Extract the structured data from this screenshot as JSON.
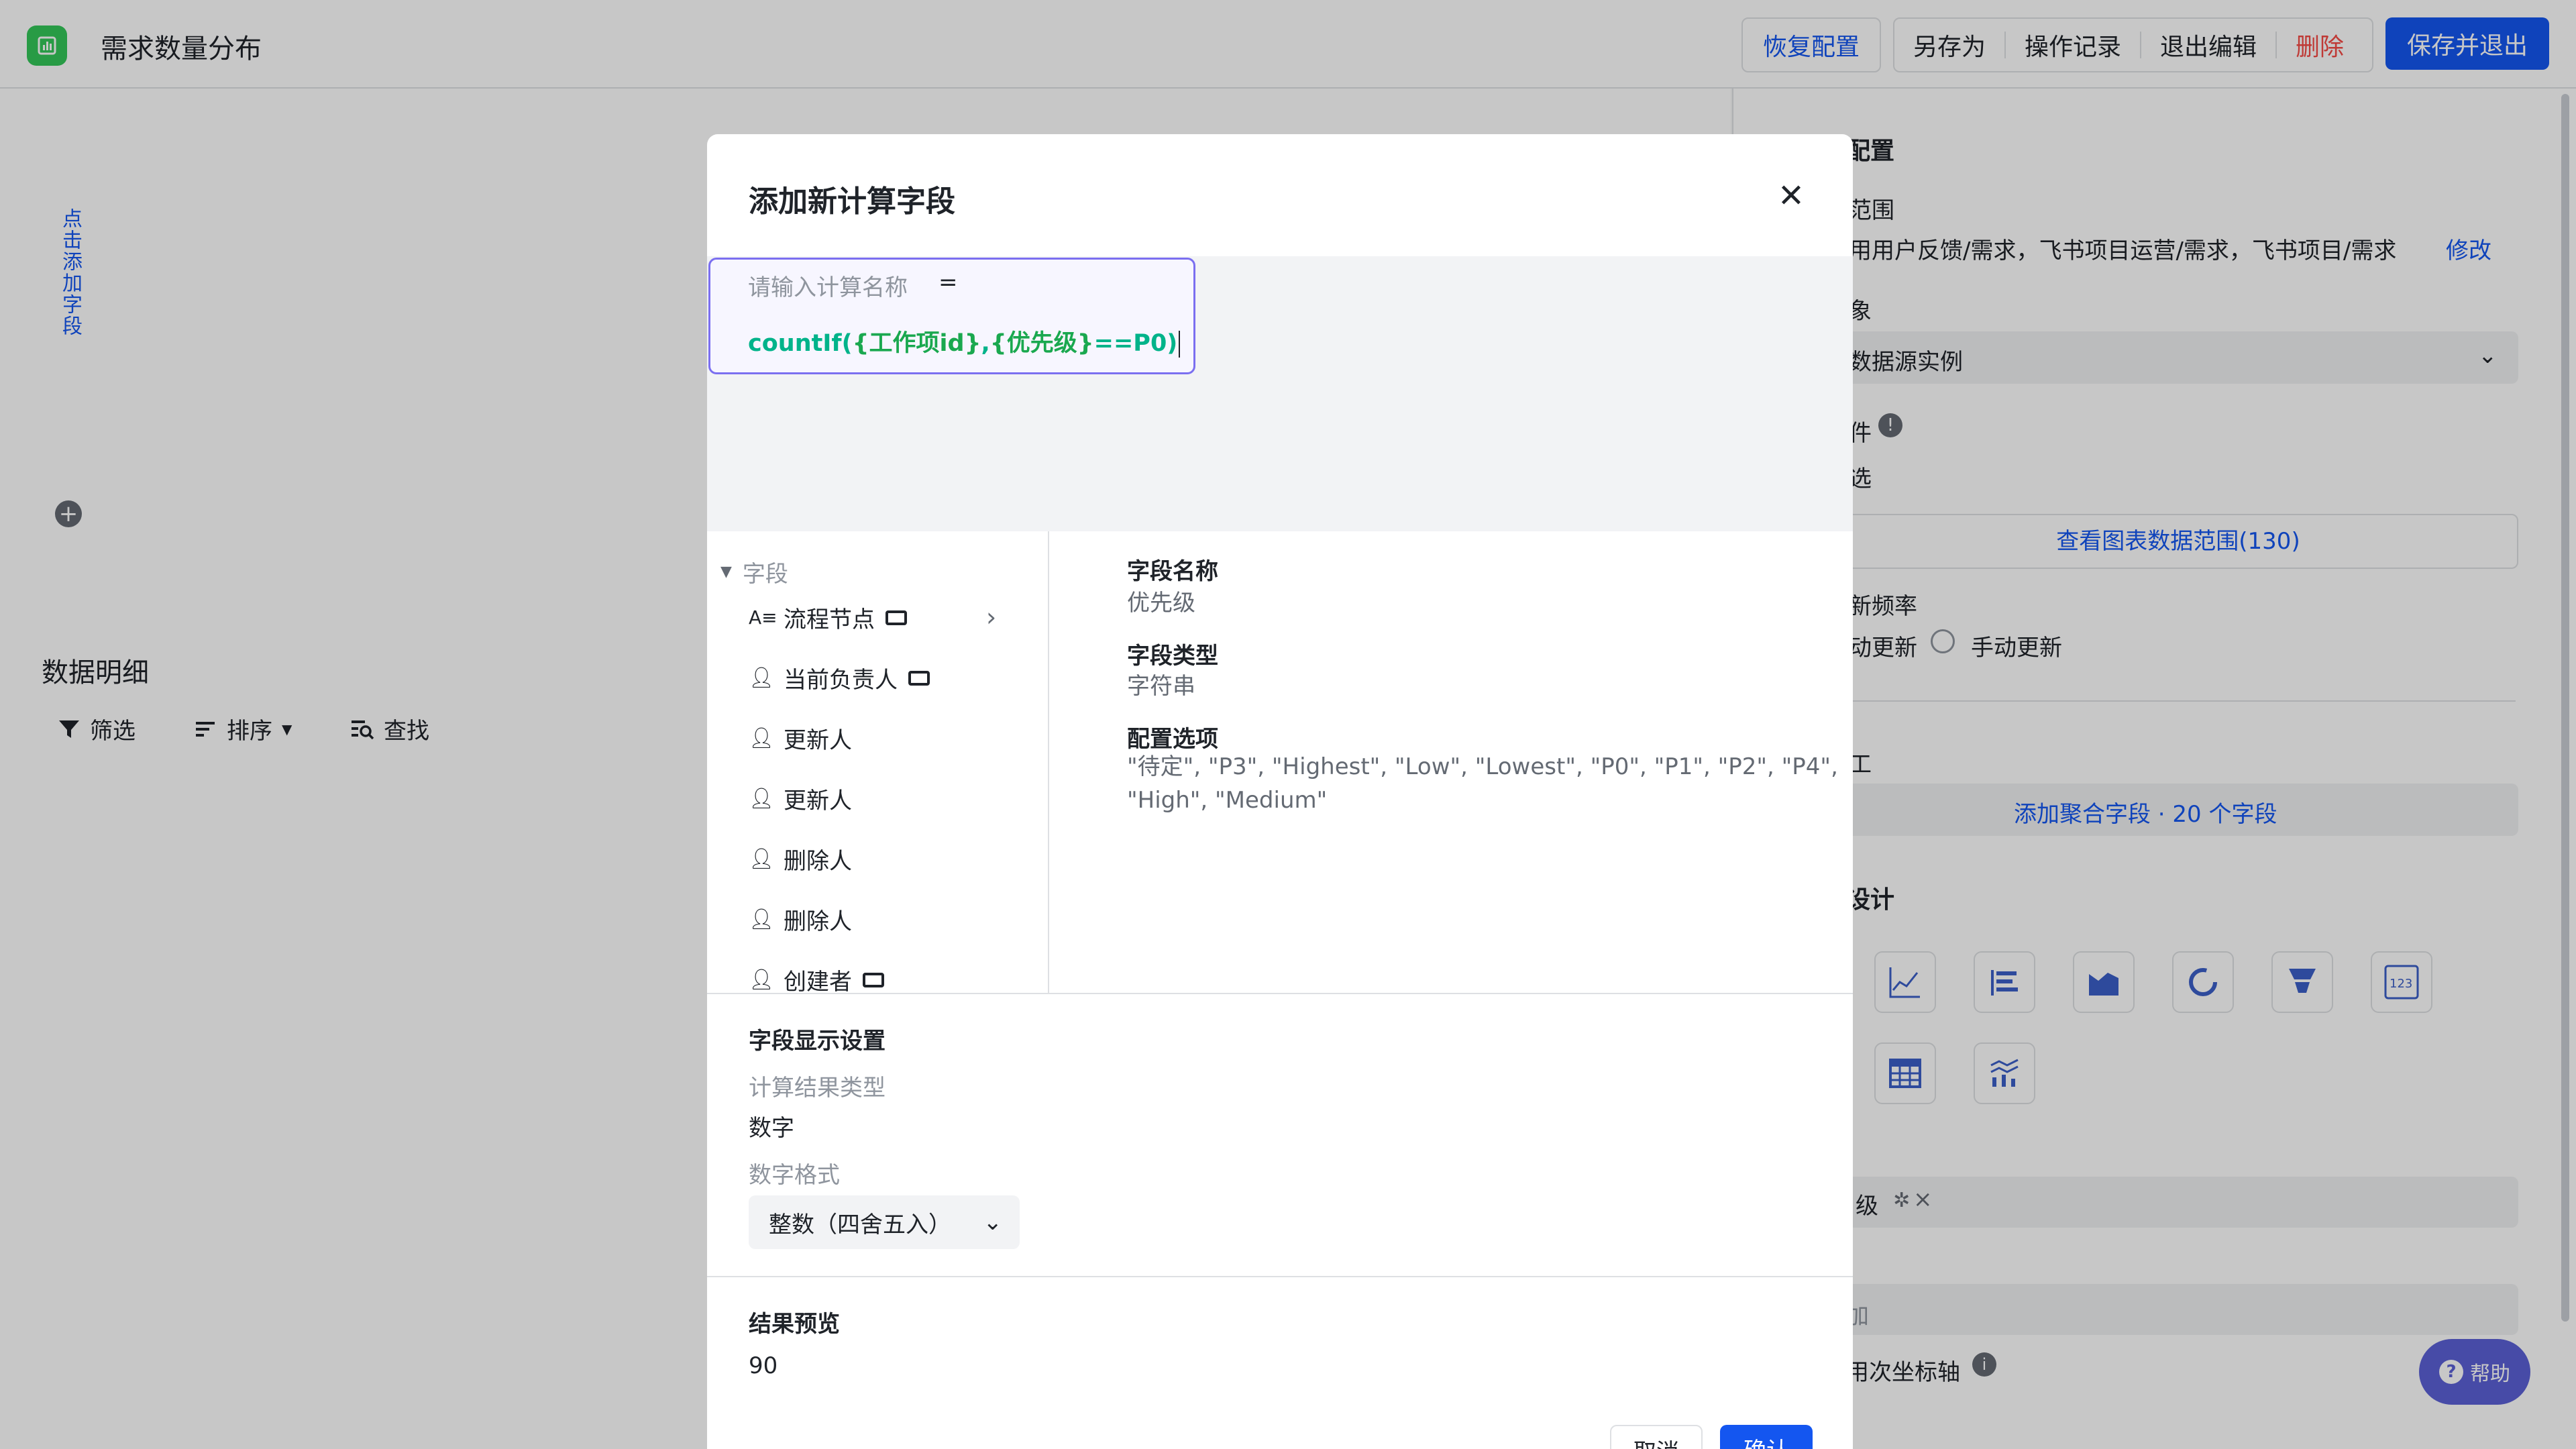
{
  "header": {
    "title": "需求数量分布",
    "restore_config": "恢复配置",
    "save_as": "另存为",
    "history": "操作记录",
    "exit_edit": "退出编辑",
    "delete": "删除",
    "save_exit": "保存并退出"
  },
  "canvas": {
    "add_field_vertical": "点击添加字段",
    "detail_title": "数据明细",
    "filter": "筛选",
    "sort": "排序",
    "find": "查找"
  },
  "right_panel": {
    "config_partial": "配置",
    "scope_partial": "范围",
    "scope_value": "用用户反馈/需求，飞书项目运营/需求，飞书项目/需求",
    "modify": "修改",
    "object_partial": "象",
    "object_value": "数据源实例",
    "condition_partial": "件",
    "condition_value": "选",
    "view_range_button": "查看图表数据范围(130)",
    "frequency_partial": "新频率",
    "auto_update": "动更新",
    "manual_update": "手动更新",
    "process_partial": "工",
    "add_agg_button": "添加聚合字段 · 20 个字段",
    "design_partial": "设计",
    "group_tag": "级",
    "add_partial": "加",
    "secondary_axis": "用次坐标轴",
    "help": "帮助"
  },
  "dialog": {
    "title": "添加新计算字段",
    "name_placeholder": "请输入计算名称",
    "equals": "=",
    "formula_fn": "countIf(",
    "formula_arg1": "{工作项id}",
    "formula_comma": ",",
    "formula_arg2": "{优先级}",
    "formula_tail": "==P0)",
    "field_section": "字段",
    "fields": [
      {
        "label": "流程节点",
        "icon": "text-field-icon"
      },
      {
        "label": "当前负责人",
        "icon": "person-icon"
      },
      {
        "label": "更新人",
        "icon": "person-icon"
      },
      {
        "label": "更新人",
        "icon": "person-icon"
      },
      {
        "label": "删除人",
        "icon": "person-icon"
      },
      {
        "label": "删除人",
        "icon": "person-icon"
      },
      {
        "label": "创建者",
        "icon": "person-icon"
      }
    ],
    "detail": {
      "name_label": "字段名称",
      "name_value": "优先级",
      "type_label": "字段类型",
      "type_value": "字符串",
      "options_label": "配置选项",
      "options_value": "\"待定\", \"P3\", \"Highest\", \"Low\", \"Lowest\", \"P0\", \"P1\", \"P2\", \"P4\", \"High\", \"Medium\""
    },
    "display_settings": "字段显示设置",
    "result_type_label": "计算结果类型",
    "result_type_value": "数字",
    "number_format_label": "数字格式",
    "number_format_value": "整数（四舍五入）",
    "preview_label": "结果预览",
    "preview_value": "90",
    "cancel": "取消",
    "confirm": "确认"
  },
  "colors": {
    "primary": "#1456f0",
    "danger": "#f54a45",
    "formula_function": "#00b38a",
    "formula_reference": "#1aa84f",
    "editor_border": "#7b6ff0"
  }
}
